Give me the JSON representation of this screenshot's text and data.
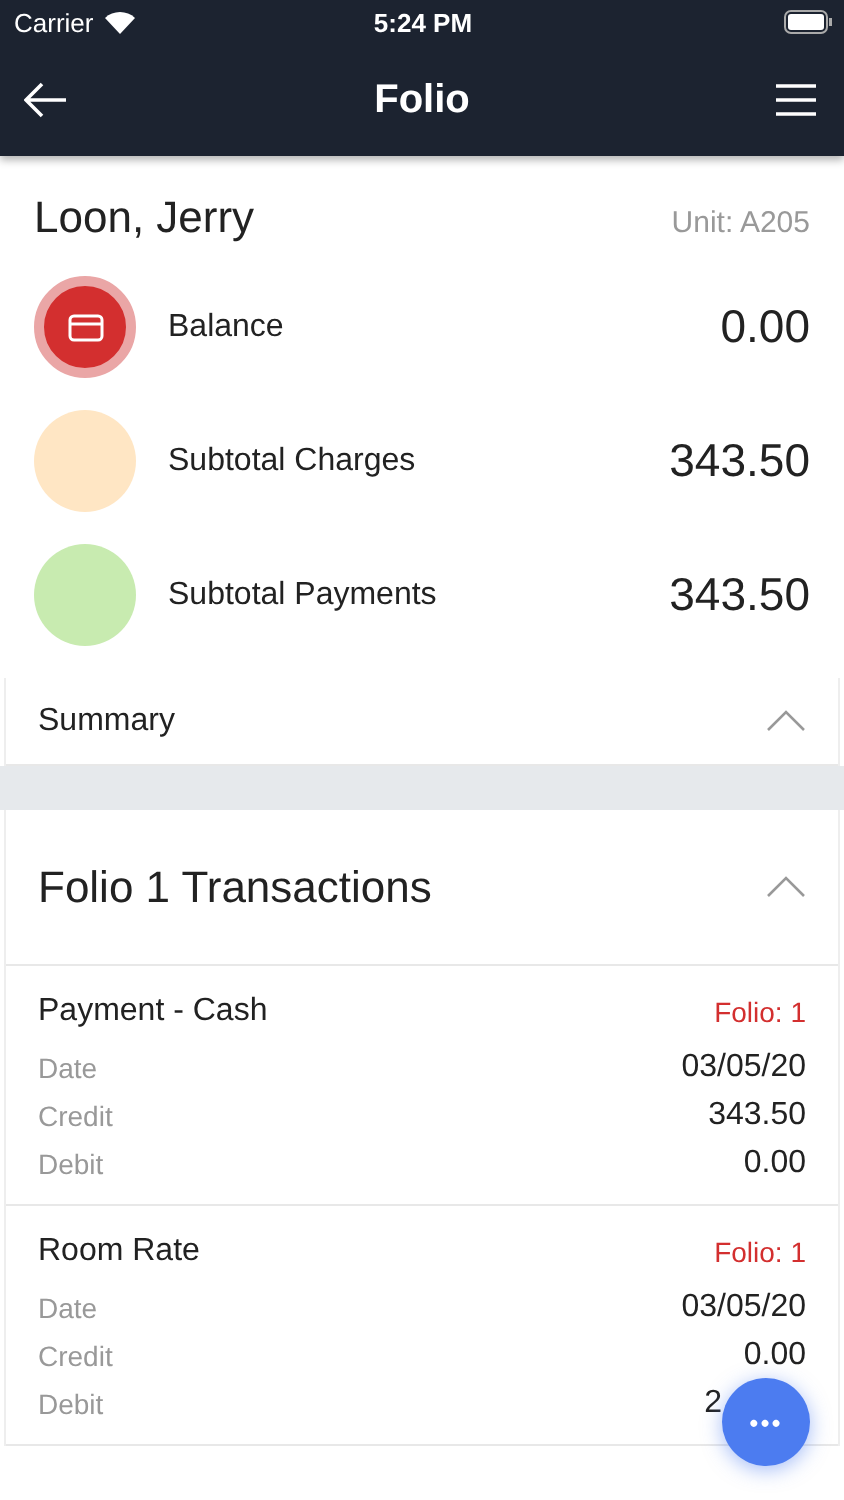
{
  "status_bar": {
    "carrier": "Carrier",
    "time": "5:24 PM"
  },
  "nav": {
    "title": "Folio"
  },
  "guest": {
    "name": "Loon, Jerry",
    "unit": "Unit: A205"
  },
  "totals": [
    {
      "kind": "balance",
      "label": "Balance",
      "value": "0.00",
      "color": "#d32f2f"
    },
    {
      "kind": "plain",
      "label": "Subtotal Charges",
      "value": "343.50",
      "color": "#ffe6c4"
    },
    {
      "kind": "plain",
      "label": "Subtotal Payments",
      "value": "343.50",
      "color": "#c8ebb0"
    }
  ],
  "summary": {
    "title": "Summary",
    "expanded": true
  },
  "folio": {
    "title": "Folio 1 Transactions",
    "expanded": true,
    "transactions": [
      {
        "name": "Payment - Cash",
        "folio": "Folio: 1",
        "fields": [
          {
            "label": "Date",
            "value": "03/05/20",
            "covered": false
          },
          {
            "label": "Credit",
            "value": "343.50",
            "covered": false
          },
          {
            "label": "Debit",
            "value": "0.00",
            "covered": false
          }
        ]
      },
      {
        "name": "Room Rate",
        "folio": "Folio: 1",
        "fields": [
          {
            "label": "Date",
            "value": "03/05/20",
            "covered": false
          },
          {
            "label": "Credit",
            "value": "0.00",
            "covered": false
          },
          {
            "label": "Debit",
            "value": "2",
            "covered": true
          }
        ]
      }
    ]
  },
  "fab": {
    "label": "•••"
  }
}
